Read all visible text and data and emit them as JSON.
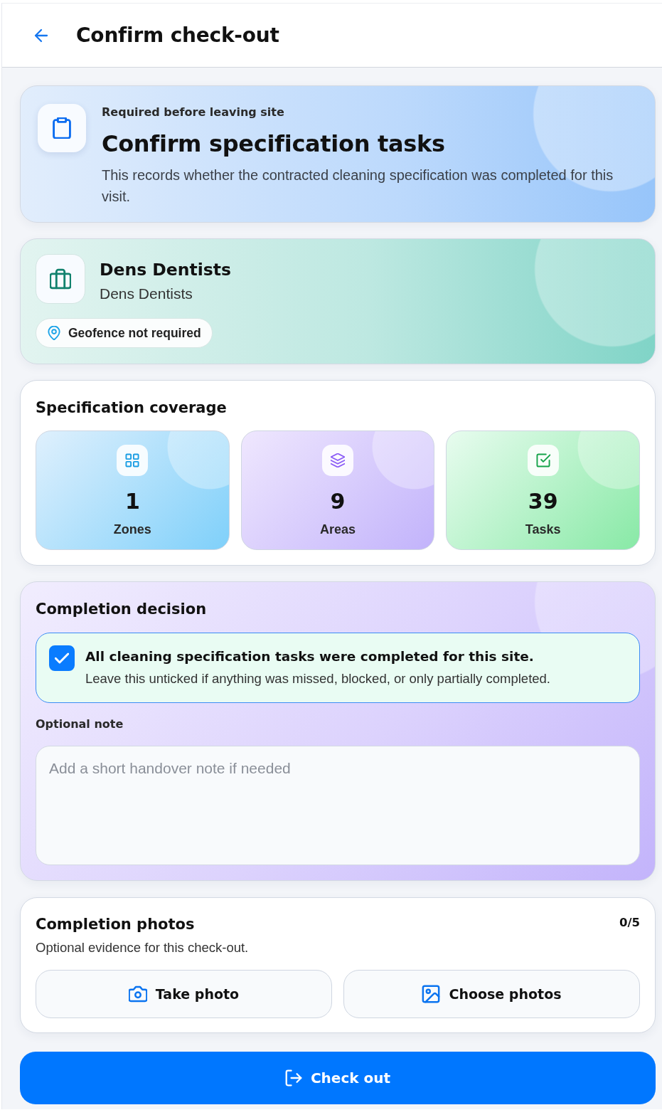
{
  "header": {
    "title": "Confirm check-out"
  },
  "intro": {
    "eyebrow": "Required before leaving site",
    "title": "Confirm specification tasks",
    "description": "This records whether the contracted cleaning specification was completed for this visit."
  },
  "site": {
    "name": "Dens Dentists",
    "subtitle": "Dens Dentists",
    "geofence": "Geofence not required"
  },
  "coverage": {
    "title": "Specification coverage",
    "stats": [
      {
        "kind": "zones",
        "value": "1",
        "label": "Zones"
      },
      {
        "kind": "areas",
        "value": "9",
        "label": "Areas"
      },
      {
        "kind": "tasks",
        "value": "39",
        "label": "Tasks"
      }
    ]
  },
  "decision": {
    "title": "Completion decision",
    "confirmation": {
      "label": "All cleaning specification tasks were completed for this site.",
      "hint": "Leave this unticked if anything was missed, blocked, or only partially completed.",
      "checked": true
    },
    "note": {
      "label": "Optional note",
      "placeholder": "Add a short handover note if needed"
    }
  },
  "photos": {
    "title": "Completion photos",
    "count": "0/5",
    "description": "Optional evidence for this check-out.",
    "buttons": [
      {
        "kind": "camera",
        "label": "Take photo"
      },
      {
        "kind": "gallery",
        "label": "Choose photos"
      }
    ]
  },
  "checkout_button": {
    "label": "Check out"
  }
}
